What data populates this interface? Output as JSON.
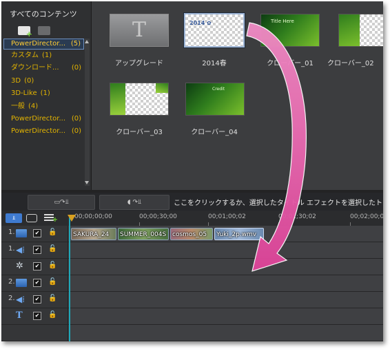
{
  "sidebar": {
    "title": "すべてのコンテンツ",
    "folder_icons": [
      "new-folder-icon",
      "folder-icon"
    ],
    "items": [
      {
        "name": "PowerDirector...",
        "count": "(5)",
        "selected": true
      },
      {
        "name": "カスタム",
        "count": "(1)"
      },
      {
        "name": "ダウンロード...",
        "count": "(0)"
      },
      {
        "name": "3D",
        "count": "(0)"
      },
      {
        "name": "3D-Like",
        "count": "(1)"
      },
      {
        "name": "一般",
        "count": "(4)"
      },
      {
        "name": "PowerDirector...",
        "count": "(0)"
      },
      {
        "name": "PowerDirector...",
        "count": "(0)"
      }
    ]
  },
  "library": {
    "tiles": [
      {
        "label": "アップグレード",
        "thumb_text": "T",
        "kind": "upgrade"
      },
      {
        "label": "2014春",
        "thumb_text": "2014 ✿",
        "kind": "checker"
      },
      {
        "label": "クローバー_01",
        "thumb_text": "Title Here",
        "kind": "green"
      },
      {
        "label": "クローバー_02",
        "thumb_text": "",
        "kind": "green-checker"
      },
      {
        "label": "クローバー_03",
        "thumb_text": "",
        "kind": "green-checker2"
      },
      {
        "label": "クローバー_04",
        "thumb_text": "Credit",
        "kind": "green"
      }
    ]
  },
  "toolbar": {
    "hint": "ここをクリックするか、選択したタイトル エフェクトを選択したト",
    "btn1_icon": "insert-to-track-icon",
    "btn2_icon": "insert-title-icon"
  },
  "timeline": {
    "track_tools": [
      "track-manager-icon",
      "view-toggle-icon",
      "add-track-icon"
    ],
    "ruler_ticks": [
      "00;00;00;00",
      "00;00;30;00",
      "00;01;00;02",
      "00;01;30;02",
      "00;02;00;04"
    ],
    "tracks": [
      {
        "num": "1.",
        "icon": "video-track-icon"
      },
      {
        "num": "1.",
        "icon": "audio-track-icon"
      },
      {
        "num": "",
        "icon": "fx-track-icon"
      },
      {
        "num": "2.",
        "icon": "video-track-icon"
      },
      {
        "num": "2.",
        "icon": "audio-track-icon"
      },
      {
        "num": "",
        "icon": "title-track-icon"
      }
    ],
    "clips": [
      "SAKURA_24",
      "SUMMER_004S",
      "cosmos_05",
      "Yuki_2p.wmv"
    ],
    "playhead_color": "#1fa8b8"
  },
  "colors": {
    "accent": "#e3b400",
    "arrow": "#e85aa8"
  }
}
